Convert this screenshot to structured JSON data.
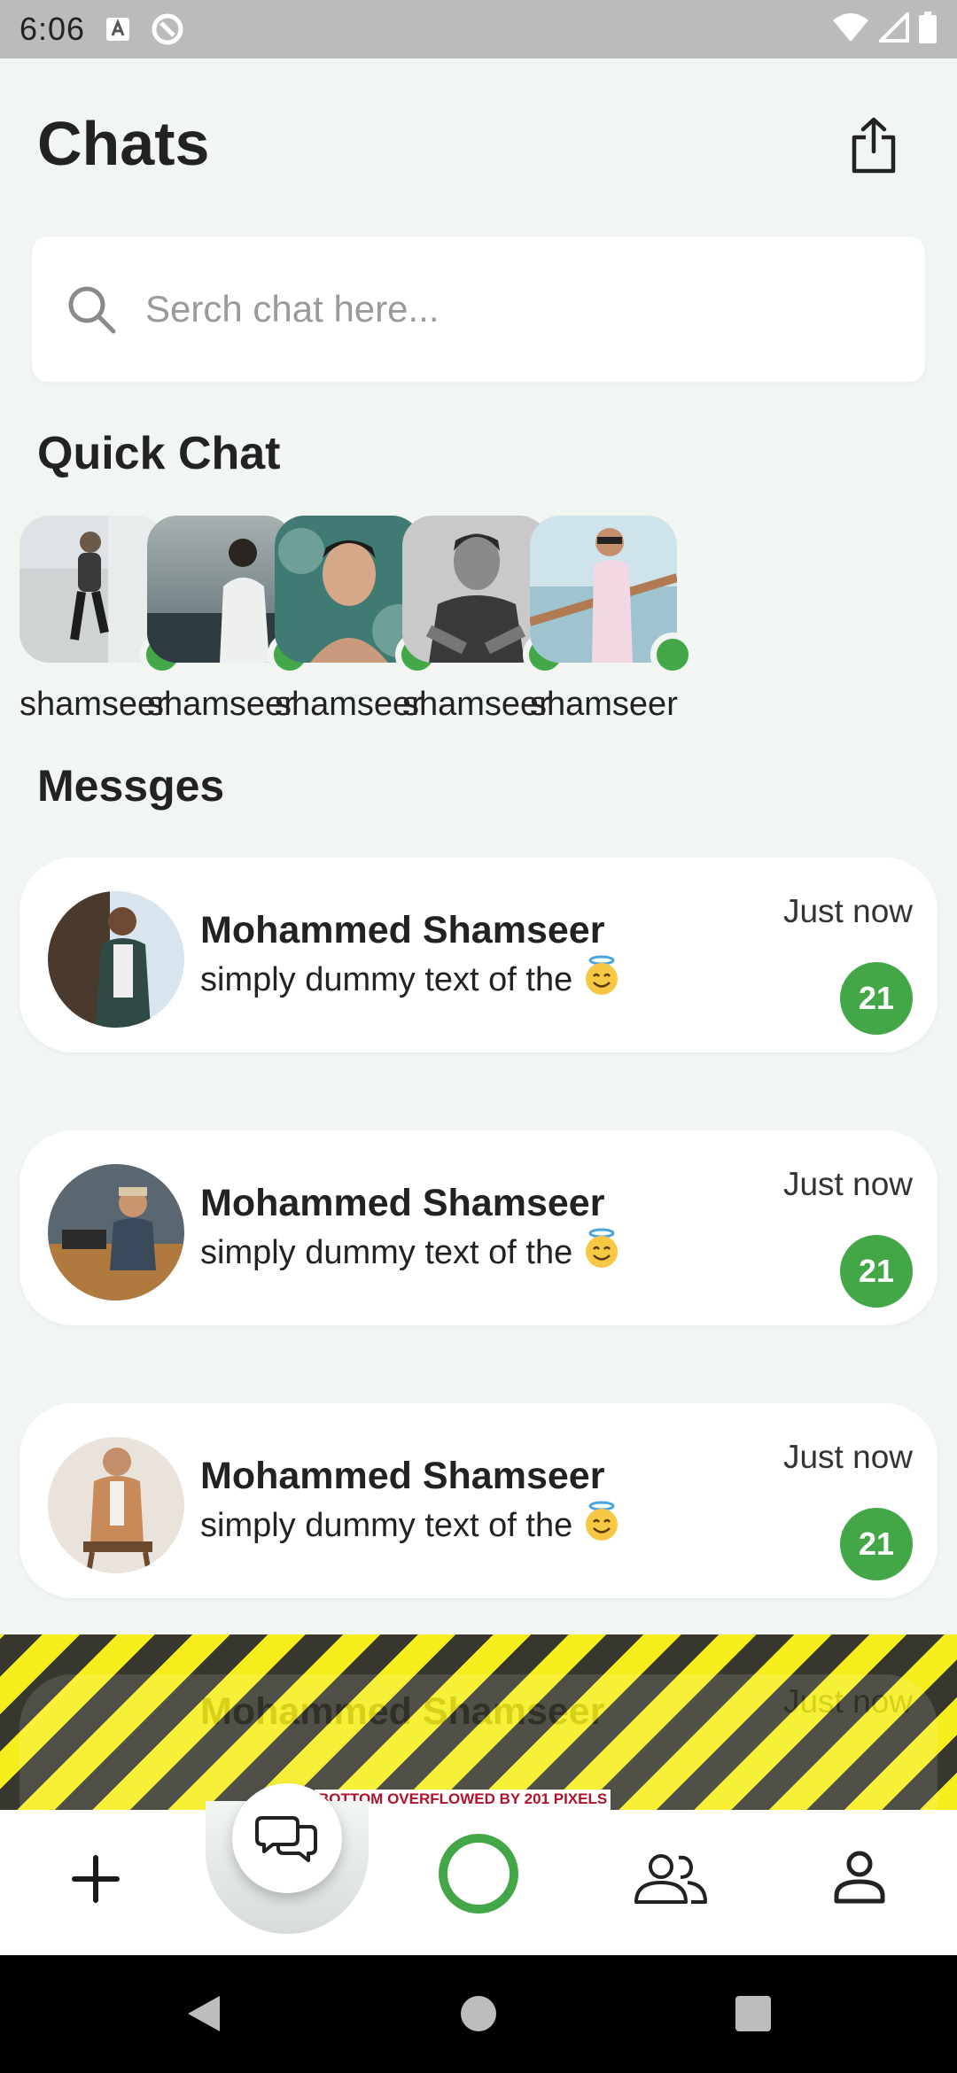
{
  "status_bar": {
    "time": "6:06"
  },
  "header": {
    "title": "Chats"
  },
  "search": {
    "placeholder": "Serch chat here..."
  },
  "quick_chat": {
    "title": "Quick Chat",
    "contacts": [
      {
        "name": "shamseer",
        "online": true
      },
      {
        "name": "shamseer",
        "online": true
      },
      {
        "name": "shamseer",
        "online": true
      },
      {
        "name": "shamseer",
        "online": true
      },
      {
        "name": "shamseer",
        "online": true
      }
    ]
  },
  "messages": {
    "title": "Messges",
    "items": [
      {
        "name": "Mohammed Shamseer",
        "preview": "simply dummy text of the",
        "time": "Just now",
        "unread": "21"
      },
      {
        "name": "Mohammed Shamseer",
        "preview": "simply dummy text of the",
        "time": "Just now",
        "unread": "21"
      },
      {
        "name": "Mohammed Shamseer",
        "preview": "simply dummy text of the",
        "time": "Just now",
        "unread": "21"
      },
      {
        "name": "Mohammed Shamseer",
        "preview": "",
        "time": "Just now",
        "unread": ""
      }
    ]
  },
  "overflow_warning": "BOTTOM OVERFLOWED BY 201 PIXELS",
  "bottom_nav": {
    "items": [
      "add-icon",
      "chat-bubbles-icon",
      "status-ring-icon",
      "people-icon",
      "profile-icon"
    ]
  },
  "colors": {
    "accent": "#43a747",
    "background": "#f1f6f2",
    "card": "#ffffff"
  }
}
